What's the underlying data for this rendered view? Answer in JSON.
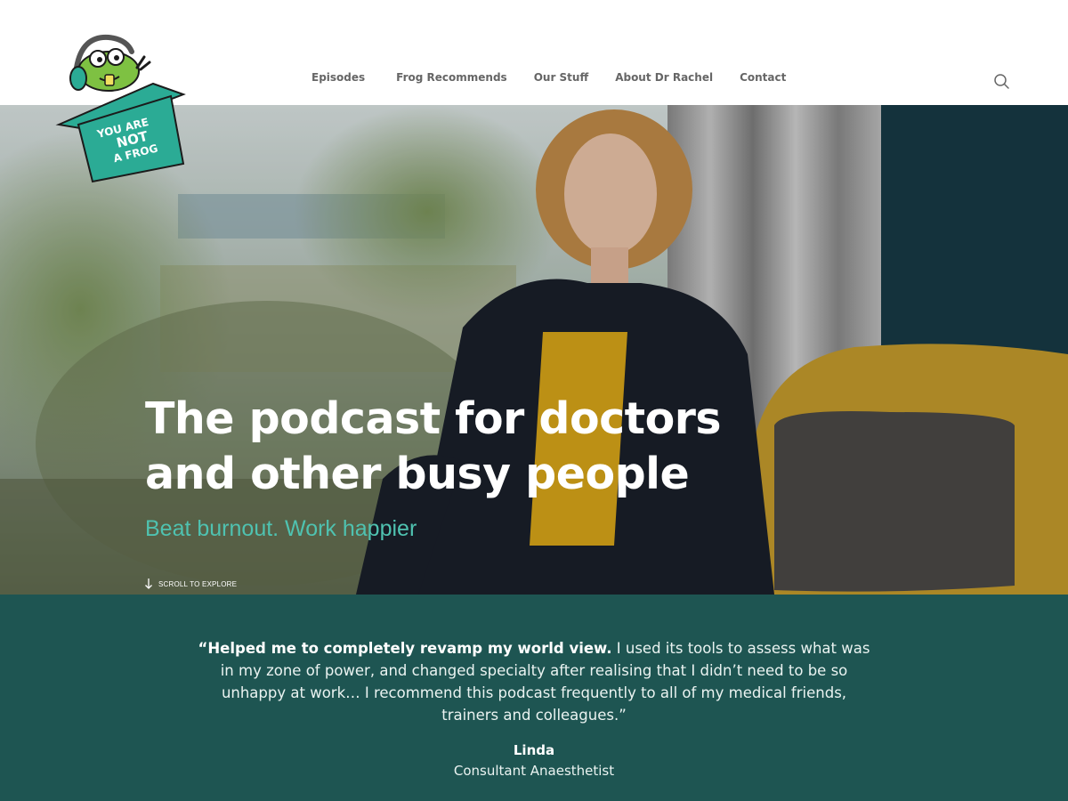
{
  "logo": {
    "text_lines": [
      "YOU ARE",
      "NOT",
      "A FROG"
    ],
    "brand_color": "#2bab95"
  },
  "nav": {
    "items": [
      {
        "label": "Episodes"
      },
      {
        "label": "Frog Recommends"
      },
      {
        "label": "Our Stuff"
      },
      {
        "label": "About Dr Rachel"
      },
      {
        "label": "Contact"
      }
    ]
  },
  "hero": {
    "title_line1": "The podcast for doctors",
    "title_line2": "and other busy people",
    "subtitle": "Beat burnout. Work happier",
    "scroll_label": "SCROLL TO EXPLORE",
    "accent_color": "#4fc2b0"
  },
  "testimonial": {
    "quote_bold": "“Helped me to completely revamp my world view.",
    "quote_rest": " I used its tools to assess what was in my zone of power, and changed specialty after realising that I didn’t need to be so unhappy at work… I recommend this podcast frequently to all of my medical friends, trainers and colleagues.”",
    "author": "Linda",
    "role": "Consultant Anaesthetist",
    "background_color": "#1e5552"
  }
}
